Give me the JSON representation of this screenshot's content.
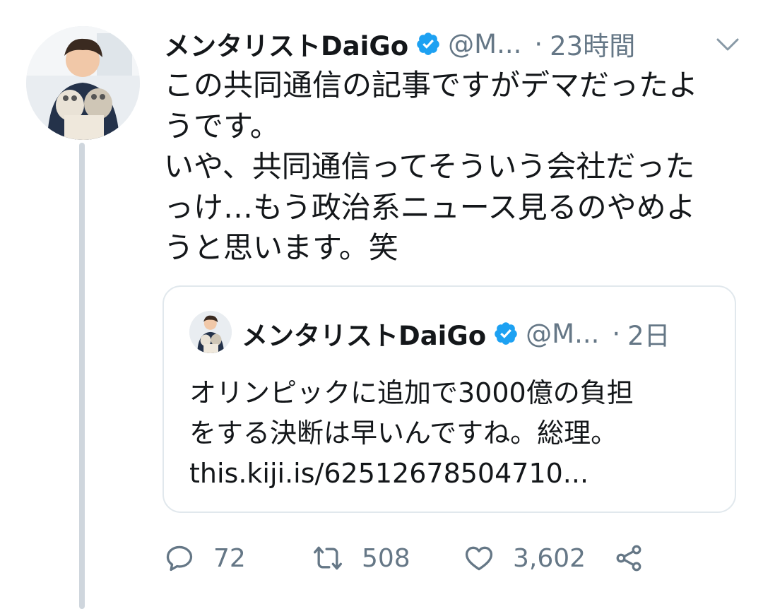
{
  "tweet": {
    "author_name": "メンタリストDaiGo",
    "handle": "@M...",
    "separator": "·",
    "time": "23時間",
    "text_lines": [
      "この共同通信の記事ですがデマだったよ",
      "うです。",
      "いや、共同通信ってそういう会社だった",
      "っけ…もう政治系ニュース見るのやめよ",
      "うと思います。笑"
    ]
  },
  "quoted_tweet": {
    "author_name": "メンタリストDaiGo",
    "handle": "@M...",
    "separator": "·",
    "time": "2日",
    "text_lines": [
      "オリンピックに追加で3000億の負担",
      "をする決断は早いんですね。総理。",
      "this.kiji.is/62512678504710..."
    ]
  },
  "actions": {
    "reply_count": "72",
    "retweet_count": "508",
    "like_count": "3,602"
  },
  "icons": {
    "verified": "verified-badge-icon",
    "chevron": "chevron-down-icon",
    "reply": "reply-icon",
    "retweet": "retweet-icon",
    "like": "heart-icon",
    "share": "share-icon"
  },
  "colors": {
    "text": "#14171a",
    "secondary": "#657786",
    "verified_blue": "#1da1f2",
    "border": "#e1e8ed",
    "thread_line": "#cfd6dd"
  }
}
